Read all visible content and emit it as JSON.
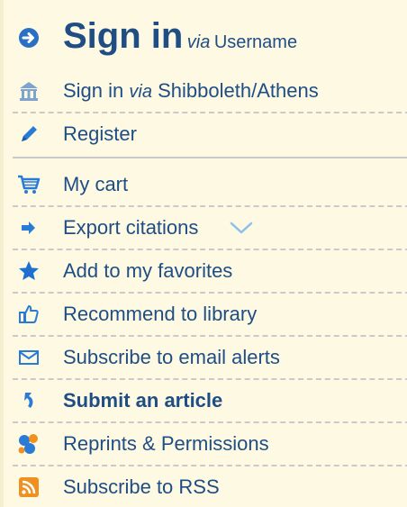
{
  "signin": {
    "title": "Sign in",
    "via": "via",
    "method": "Username"
  },
  "shibboleth": {
    "prefix": "Sign in",
    "via": "via",
    "method": "Shibboleth/Athens"
  },
  "register": {
    "label": "Register"
  },
  "tools": [
    {
      "label": "My cart",
      "icon": "cart-icon"
    },
    {
      "label": "Export citations",
      "icon": "export-arrow-icon"
    },
    {
      "label": "Add to my favorites",
      "icon": "star-icon"
    },
    {
      "label": "Recommend to library",
      "icon": "thumbs-up-icon"
    },
    {
      "label": "Subscribe to email alerts",
      "icon": "envelope-icon"
    },
    {
      "label": "Submit an article",
      "icon": "submit-article-icon"
    },
    {
      "label": "Reprints & Permissions",
      "icon": "reprints-icon"
    },
    {
      "label": "Subscribe to RSS",
      "icon": "rss-icon"
    }
  ],
  "colors": {
    "link": "#1f4e85",
    "icon_blue": "#2a7bd6",
    "rss_orange": "#f0901e",
    "background": "#fdf9e3"
  }
}
